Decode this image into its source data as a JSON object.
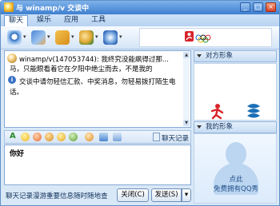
{
  "window": {
    "title": "与 winamp/v 交谈中",
    "minimize_glyph": "_",
    "maximize_glyph": "□",
    "close_glyph": "×"
  },
  "menu": {
    "items": [
      {
        "label": "聊天",
        "active": true
      },
      {
        "label": "娱乐",
        "active": false
      },
      {
        "label": "应用",
        "active": false
      },
      {
        "label": "工具",
        "active": false
      }
    ]
  },
  "toolbar": {
    "icons": [
      "webcam-icon",
      "voice-icon",
      "file-transfer-icon",
      "invite-icon",
      "app-share-icon"
    ],
    "banner": {
      "icon": "beijing-2008-olympic-logo"
    }
  },
  "chat": {
    "messages": [
      {
        "avatar": "avatar",
        "line1": "winamp/v(147053744): 我终究没能飙得过那...",
        "line2": "马，只能眼看着它在夕阳中绝尘而去，不是我的"
      },
      {
        "icon": "info-icon",
        "line1": "交谈中请勿轻信汇款、中奖消息，勿轻易拨打陌生电",
        "line2": "话。"
      }
    ]
  },
  "input_toolbar": {
    "history_label": "聊天记录"
  },
  "input": {
    "value": "你好"
  },
  "status": {
    "text": "聊天记录漫游重要信息随时随地查"
  },
  "buttons": {
    "close_label": "关闭(C)",
    "send_label": "发送(S)",
    "send_dropdown_glyph": "▾"
  },
  "right_panel": {
    "peer_header": "对方形象",
    "my_header": "我的形象",
    "show_line1": "点此",
    "show_line2": "免费拥有QQ秀"
  },
  "colors": {
    "titlebar": "#3f7fd0",
    "accent": "#1f4f8a",
    "olympic_red": "#d8232a",
    "china_mobile_blue": "#1b6fb7"
  }
}
